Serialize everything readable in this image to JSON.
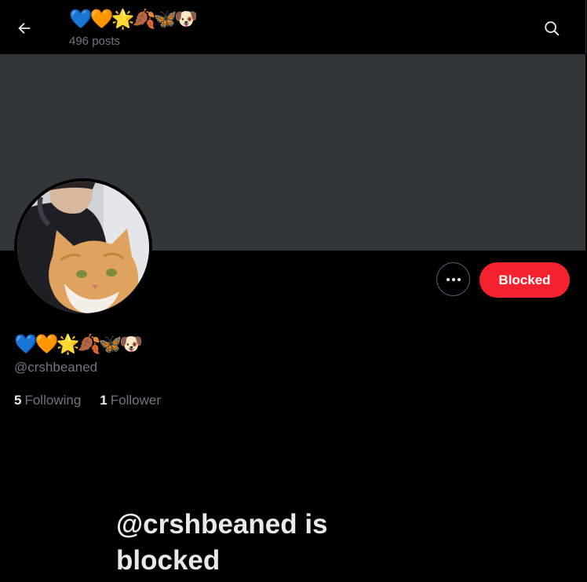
{
  "header": {
    "title": "💙🧡🌟🍂🦋🐶",
    "post_count": "496 posts",
    "back_icon": "arrow-left-icon",
    "search_icon": "search-icon"
  },
  "banner": {
    "color": "#31363a"
  },
  "profile": {
    "display_name": "💙🧡🌟🍂🦋🐶",
    "handle": "@crshbeaned",
    "following_count": "5",
    "following_label": "Following",
    "followers_count": "1",
    "followers_label": "Follower"
  },
  "actions": {
    "more_icon": "ellipsis-icon",
    "blocked_label": "Blocked",
    "blocked_color": "#f4212e"
  },
  "blocked_notice": {
    "message": "@crshbeaned is blocked"
  }
}
